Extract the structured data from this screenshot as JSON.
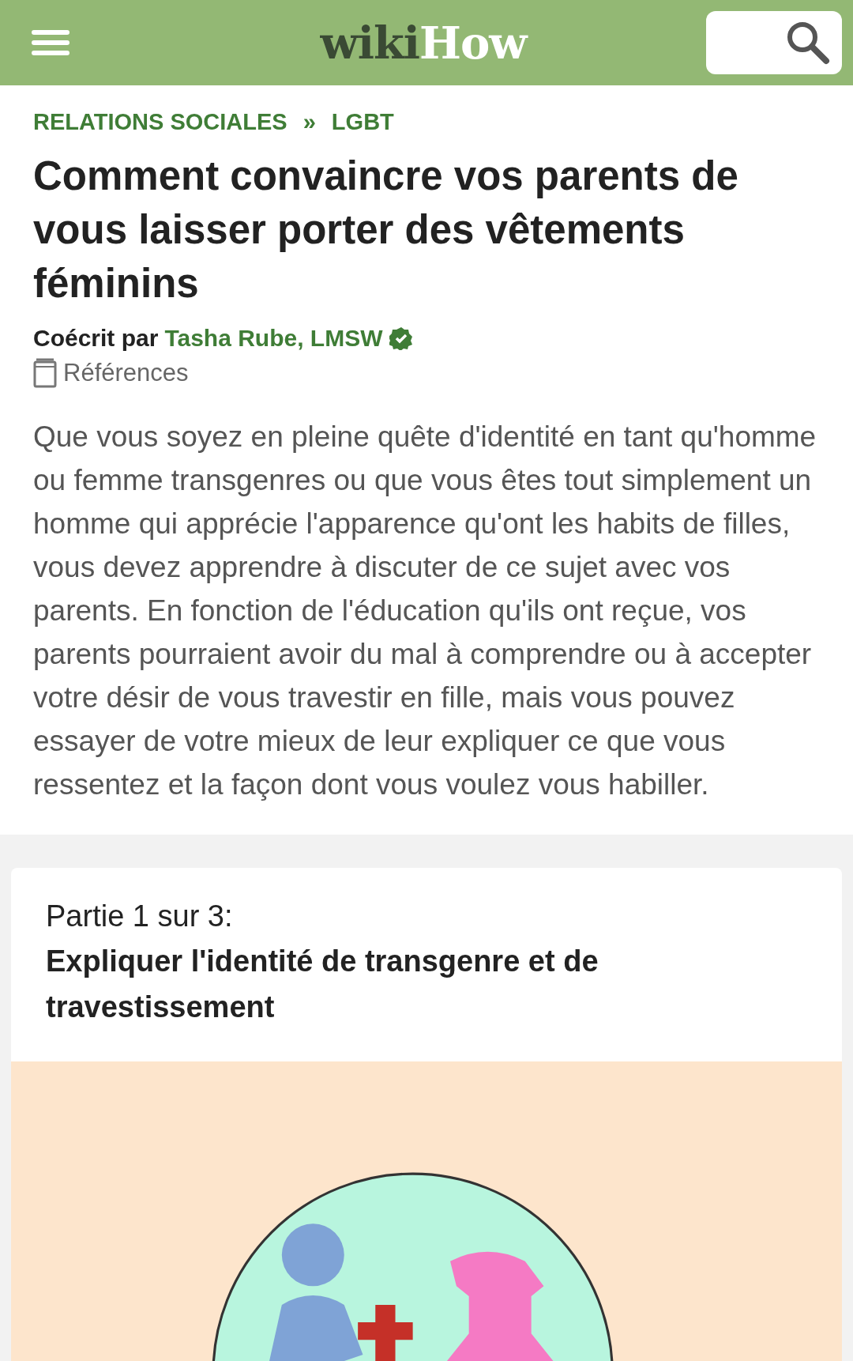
{
  "header": {
    "logo": {
      "first": "wiki",
      "second": "How"
    }
  },
  "breadcrumb": {
    "items": [
      "RELATIONS SOCIALES",
      "LGBT"
    ],
    "separator": "»"
  },
  "title": "Comment convaincre vos parents de vous laisser porter des vêtements féminins",
  "byline": {
    "prefix": "Coécrit par",
    "author": "Tasha Rube, LMSW",
    "verified": true
  },
  "references": "Références",
  "intro": "Que vous soyez en pleine quête d'identité en tant qu'homme ou femme transgenres ou que vous êtes tout simplement un homme qui apprécie l'apparence qu'ont les habits de filles, vous devez apprendre à discuter de ce sujet avec vos parents. En fonction de l'éducation qu'ils ont reçue, vos parents pourraient avoir du mal à comprendre ou à accepter votre désir de vous travestir en fille, mais vous pouvez essayer de votre mieux de leur expliquer ce que vous ressentez et la façon dont vous voulez vous habiller.",
  "section": {
    "part": "Partie 1 sur 3:",
    "heading": "Expliquer l'identité de transgenre et de travestissement"
  }
}
